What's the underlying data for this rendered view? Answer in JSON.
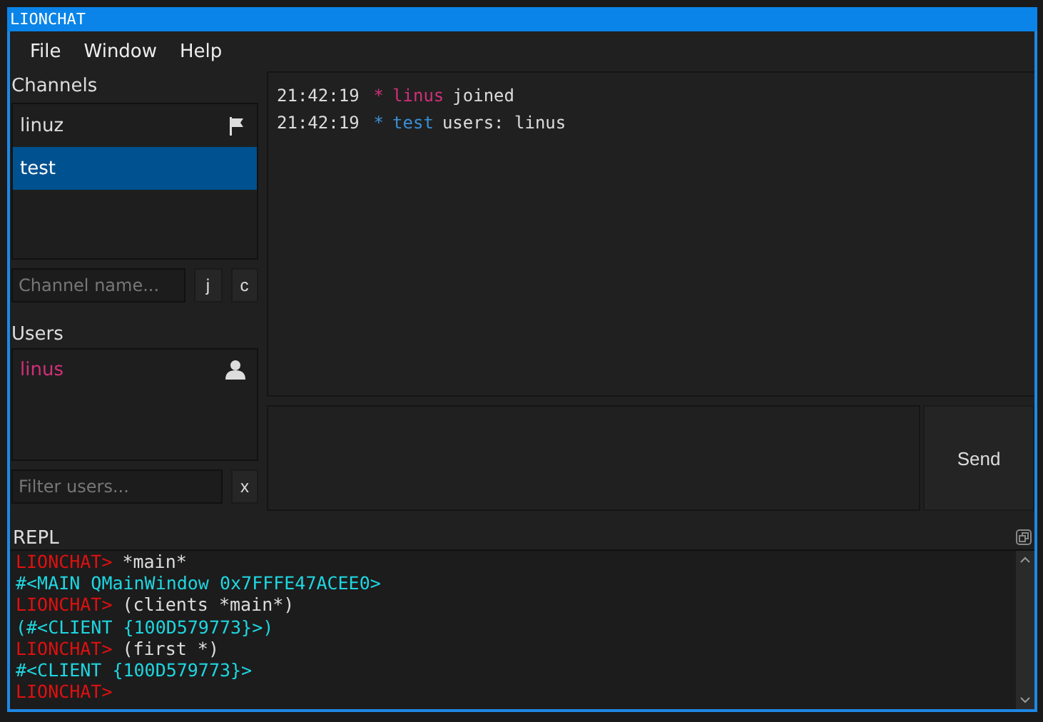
{
  "window": {
    "title": "LIONCHAT"
  },
  "menu": [
    "File",
    "Window",
    "Help"
  ],
  "channels": {
    "label": "Channels",
    "items": [
      {
        "name": "linuz",
        "selected": false,
        "flag": true
      },
      {
        "name": "test",
        "selected": true,
        "flag": false
      }
    ],
    "input": {
      "placeholder": "Channel name..."
    },
    "buttons": [
      "j",
      "c"
    ]
  },
  "users": {
    "label": "Users",
    "items": [
      {
        "name": "linus",
        "color": "#d1307a"
      }
    ],
    "filter": {
      "placeholder": "Filter users..."
    },
    "clear_button": "x"
  },
  "messages": [
    {
      "time": "21:42:19",
      "marker": "*",
      "source": "linus",
      "color": "#d1307a",
      "text": "joined"
    },
    {
      "time": "21:42:19",
      "marker": "*",
      "source": "test",
      "color": "#3a8fd6",
      "text": "users: linus"
    }
  ],
  "send_button": "Send",
  "repl": {
    "label": "REPL",
    "lines": [
      {
        "kind": "input",
        "prompt": "LIONCHAT>",
        "text": "*main*"
      },
      {
        "kind": "output",
        "text": "#<MAIN QMainWindow 0x7FFFE47ACEE0>"
      },
      {
        "kind": "input",
        "prompt": "LIONCHAT>",
        "text": "(clients *main*)"
      },
      {
        "kind": "output",
        "text": "(#<CLIENT {100D579773}>)"
      },
      {
        "kind": "input",
        "prompt": "LIONCHAT>",
        "text": "(first *)"
      },
      {
        "kind": "output",
        "text": "#<CLIENT {100D579773}>"
      },
      {
        "kind": "input",
        "prompt": "LIONCHAT>"
      }
    ]
  }
}
